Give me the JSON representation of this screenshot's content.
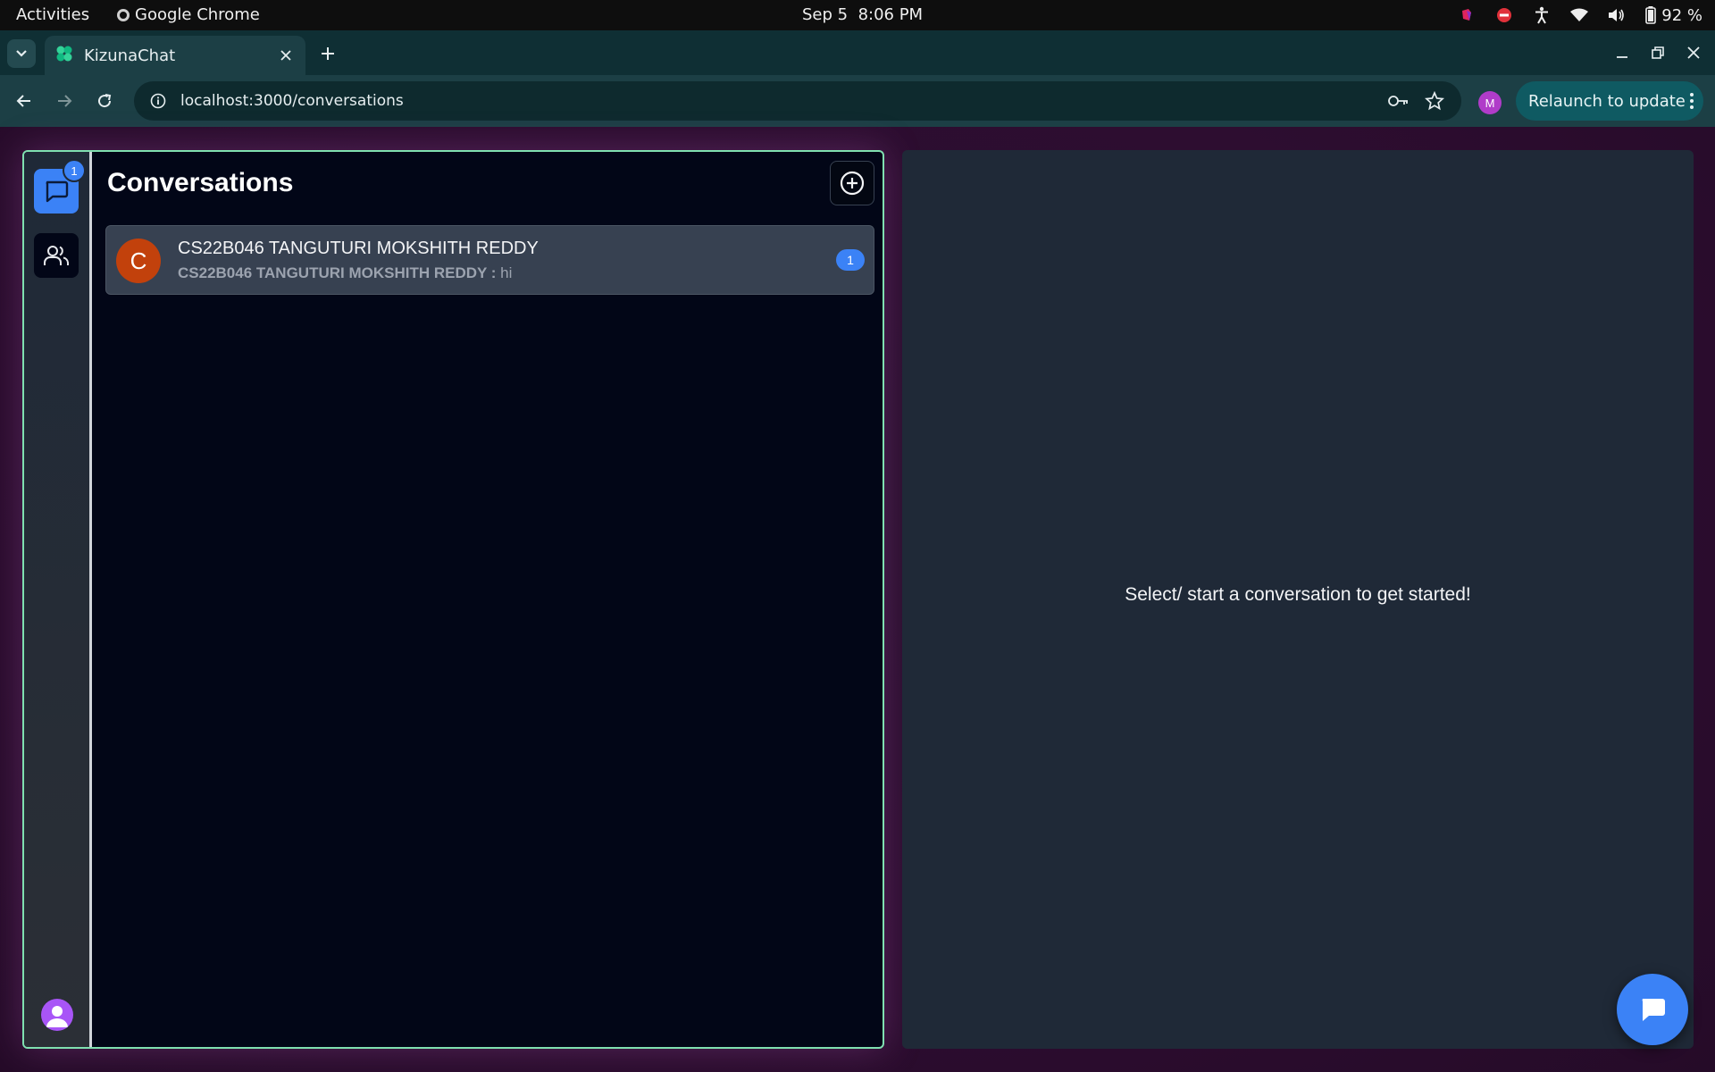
{
  "system_bar": {
    "activities": "Activities",
    "app_name": "Google Chrome",
    "date": "Sep 5",
    "time": "8:06 PM",
    "battery": "92 %",
    "icons": [
      "app-indicator-icon",
      "do-not-disturb-icon",
      "accessibility-icon",
      "wifi-icon",
      "volume-icon",
      "battery-icon"
    ]
  },
  "browser": {
    "tab_title": "KizunaChat",
    "url": "localhost:3000/conversations",
    "profile_initial": "M",
    "relaunch_label": "Relaunch to update"
  },
  "app": {
    "rail": {
      "conversations_badge": "1"
    },
    "panel_title": "Conversations",
    "conversations": [
      {
        "avatar_letter": "C",
        "name": "CS22B046 TANGUTURI MOKSHITH REDDY",
        "preview_sender": "CS22B046 TANGUTURI MOKSHITH REDDY :",
        "preview_text": " hi",
        "unread": "1"
      }
    ],
    "empty_state": "Select/ start a conversation to get started!"
  },
  "colors": {
    "accent_blue": "#3b82f6",
    "panel_border": "#7fe0b0",
    "avatar_orange": "#c2410c",
    "page_bg": "#2d0d30"
  }
}
